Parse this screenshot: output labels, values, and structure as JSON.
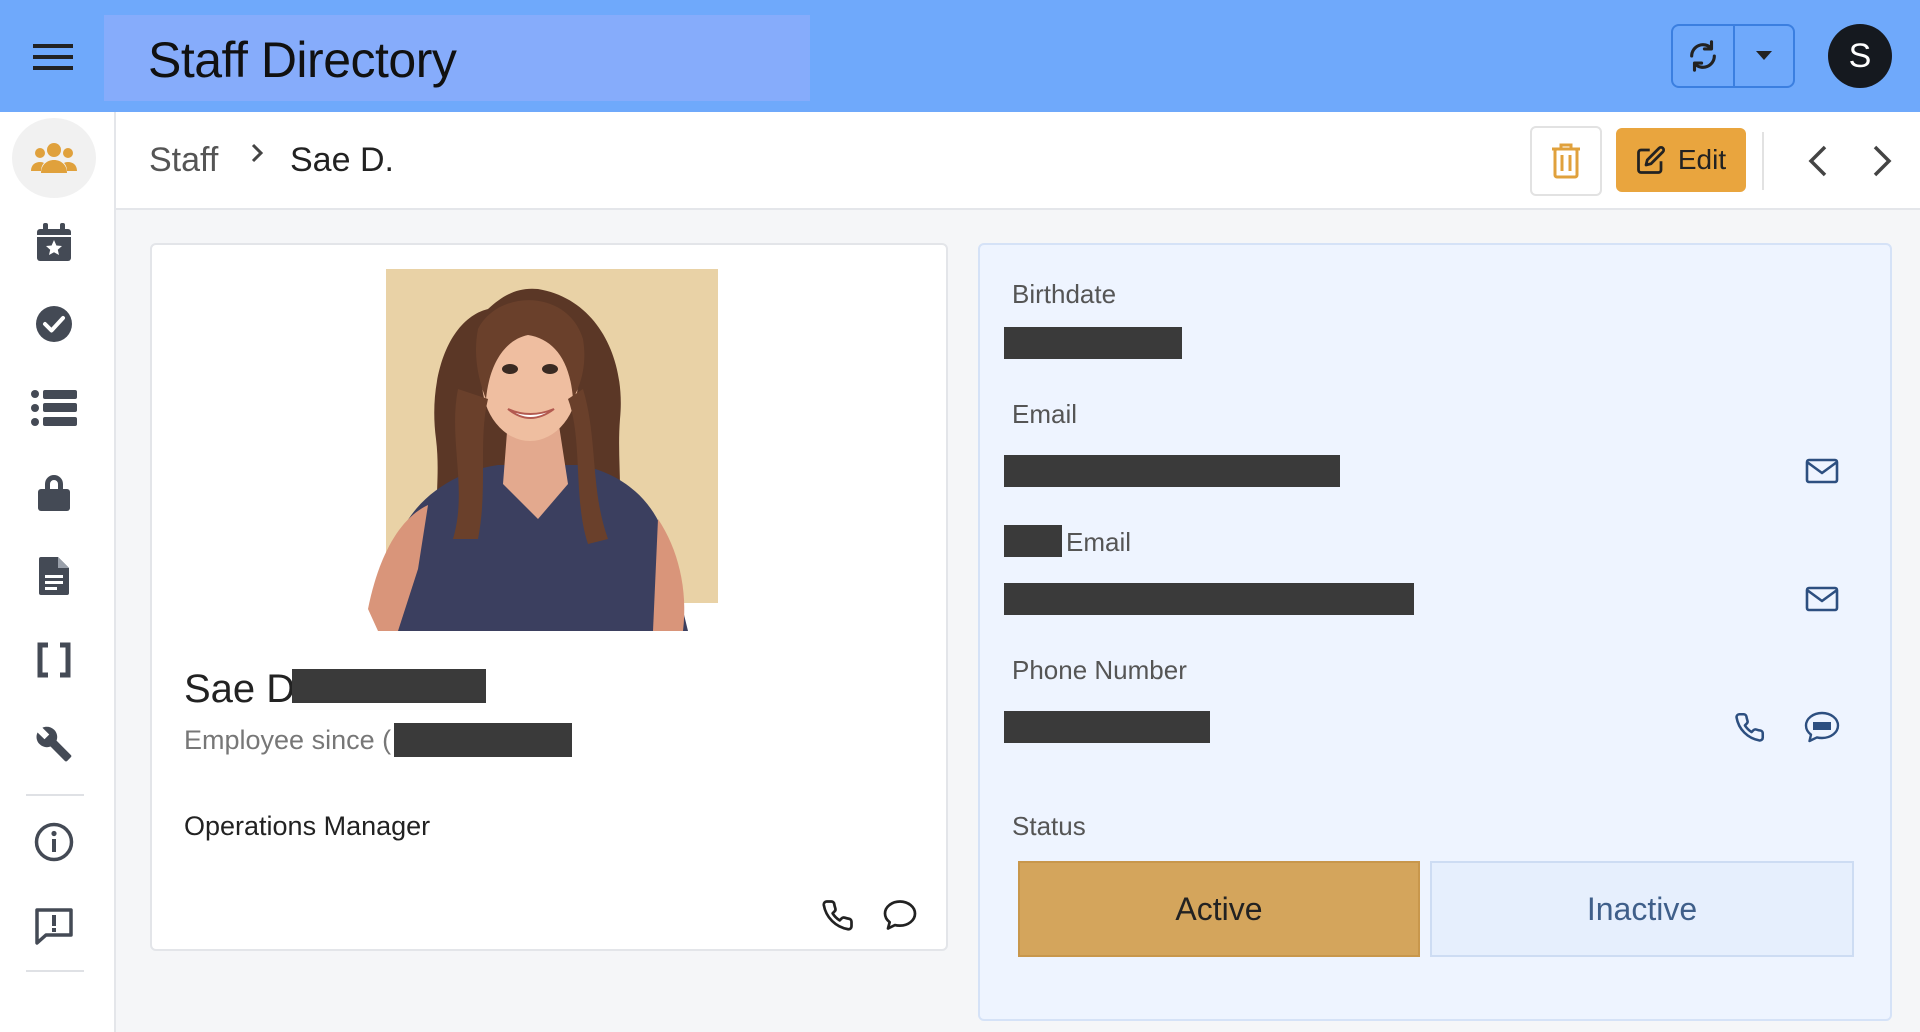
{
  "header": {
    "title": "Staff Directory",
    "avatar_initial": "S"
  },
  "breadcrumb": {
    "root": "Staff",
    "current": "Sae D."
  },
  "toolbar": {
    "edit_label": "Edit"
  },
  "profile": {
    "name": "Sae D",
    "employee_since_label": "Employee since (",
    "job_title": "Operations Manager"
  },
  "details": {
    "birthdate_label": "Birthdate",
    "email_label": "Email",
    "second_email_label": "Email",
    "phone_label": "Phone Number",
    "status_label": "Status"
  },
  "status": {
    "options": [
      "Active",
      "Inactive"
    ],
    "selected": "Active"
  },
  "colors": {
    "topbar": "#6fa9fb",
    "accent": "#e9a53e",
    "active_status": "#d4a55c",
    "panel": "#eef4ff",
    "icon": "#444a55",
    "link_icon": "#2d4f80"
  },
  "sidebar": {
    "items": [
      {
        "icon": "users-icon"
      },
      {
        "icon": "calendar-star-icon"
      },
      {
        "icon": "check-circle-icon"
      },
      {
        "icon": "list-icon"
      },
      {
        "icon": "lock-icon"
      },
      {
        "icon": "document-icon"
      },
      {
        "icon": "brackets-icon"
      },
      {
        "icon": "wrench-icon"
      },
      {
        "icon": "info-icon"
      },
      {
        "icon": "feedback-icon"
      }
    ]
  }
}
